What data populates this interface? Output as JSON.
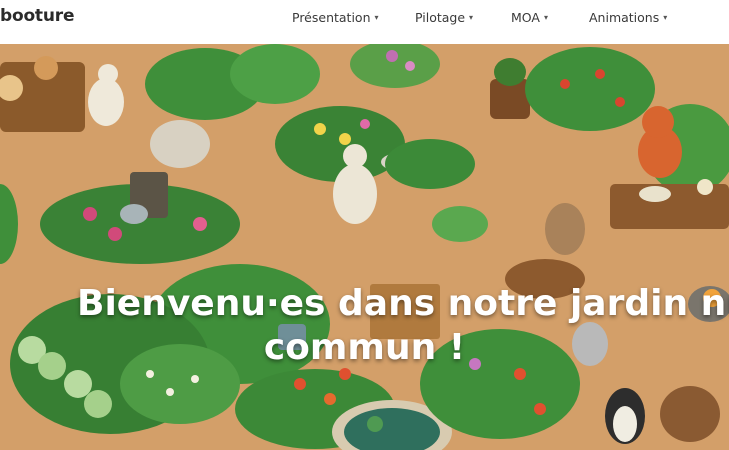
{
  "nav": {
    "brand": "booture",
    "items": [
      {
        "label": "Présentation",
        "caret": "▾"
      },
      {
        "label": "Pilotage",
        "caret": "▾"
      },
      {
        "label": "MOA",
        "caret": "▾"
      },
      {
        "label": "Animations",
        "caret": "▾"
      }
    ]
  },
  "hero": {
    "line1": "Bienvenu·es dans notre jardin num",
    "line2": "commun !"
  },
  "colors": {
    "path": "#d9a872",
    "foliage": "#3f8f3a",
    "text": "#ffffff"
  }
}
